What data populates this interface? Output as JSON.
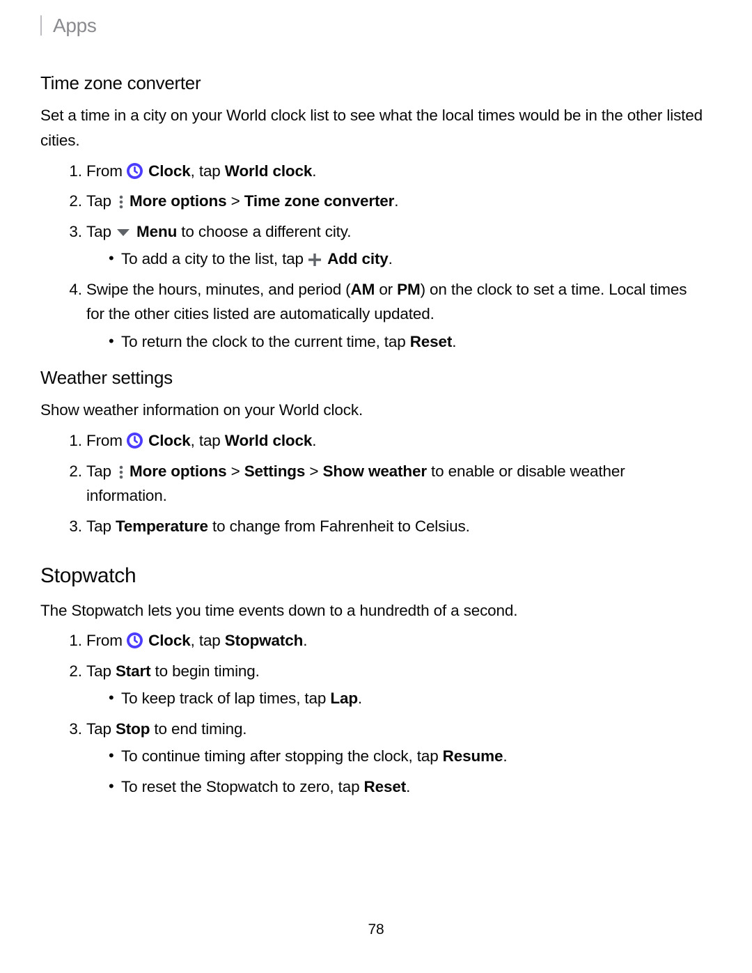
{
  "header": {
    "breadcrumb": "Apps"
  },
  "pageNumber": "78",
  "icons": {
    "clock": "clock-icon",
    "more": "more-options-icon",
    "menu": "menu-caret-icon",
    "add": "add-icon"
  },
  "s1": {
    "title": "Time zone converter",
    "intro": "Set a time in a city on your World clock list to see what the local times would be in the other listed cities.",
    "step1": {
      "pre": "From ",
      "clock_b": "Clock",
      "mid": ", tap ",
      "world_b": "World clock",
      "post": "."
    },
    "step2": {
      "pre": "Tap ",
      "more_b": "More options",
      "gt": " > ",
      "tz_b": "Time zone converter",
      "post": "."
    },
    "step3": {
      "pre": "Tap ",
      "menu_b": "Menu",
      "post": " to choose a different city."
    },
    "step3a": {
      "pre": "To add a city to the list, tap ",
      "add_b": "Add city",
      "post": "."
    },
    "step4": {
      "pre": "Swipe the hours, minutes, and period (",
      "am_b": "AM",
      "or": " or ",
      "pm_b": "PM",
      "post": ") on the clock to set a time. Local times for the other cities listed are automatically updated."
    },
    "step4a": {
      "pre": "To return the clock to the current time, tap ",
      "reset_b": "Reset",
      "post": "."
    }
  },
  "s2": {
    "title": "Weather settings",
    "intro": "Show weather information on your World clock.",
    "step1": {
      "pre": "From ",
      "clock_b": "Clock",
      "mid": ", tap ",
      "world_b": "World clock",
      "post": "."
    },
    "step2": {
      "pre": "Tap ",
      "more_b": "More options",
      "gt1": " > ",
      "settings_b": "Settings",
      "gt2": " > ",
      "weather_b": "Show weather",
      "post": " to enable or disable weather information."
    },
    "step3": {
      "pre": "Tap ",
      "temp_b": "Temperature",
      "post": " to change from Fahrenheit to Celsius."
    }
  },
  "s3": {
    "title": "Stopwatch",
    "intro": "The Stopwatch lets you time events down to a hundredth of a second.",
    "step1": {
      "pre": "From ",
      "clock_b": "Clock",
      "mid": ", tap ",
      "sw_b": "Stopwatch",
      "post": "."
    },
    "step2": {
      "pre": "Tap ",
      "start_b": "Start",
      "post": " to begin timing."
    },
    "step2a": {
      "pre": "To keep track of lap times, tap ",
      "lap_b": "Lap",
      "post": "."
    },
    "step3": {
      "pre": "Tap ",
      "stop_b": "Stop",
      "post": " to end timing."
    },
    "step3a": {
      "pre": "To continue timing after stopping the clock, tap ",
      "resume_b": "Resume",
      "post": "."
    },
    "step3b": {
      "pre": "To reset the Stopwatch to zero, tap ",
      "reset_b": "Reset",
      "post": "."
    }
  }
}
